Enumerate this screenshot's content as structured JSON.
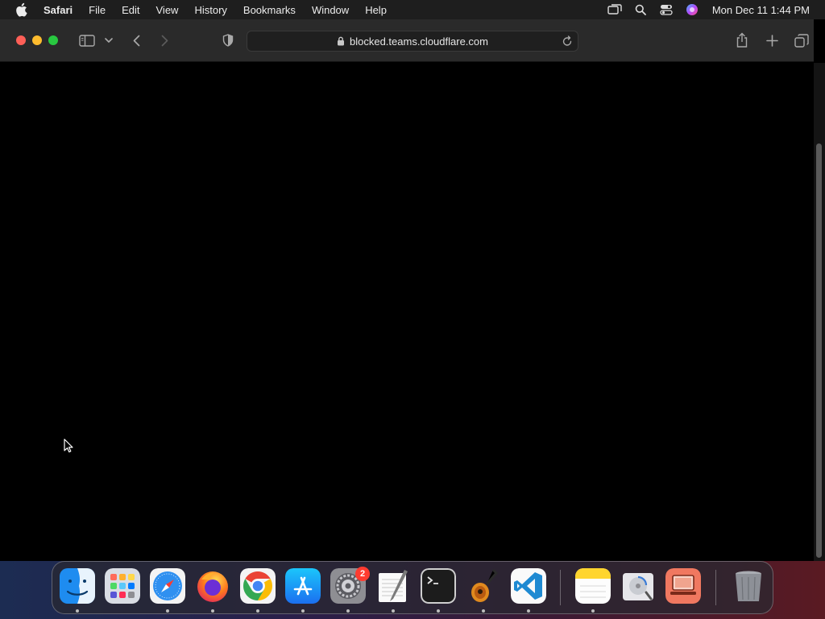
{
  "menubar": {
    "app_name": "Safari",
    "items": [
      "File",
      "Edit",
      "View",
      "History",
      "Bookmarks",
      "Window",
      "Help"
    ],
    "clock": "Mon Dec 11  1:44 PM"
  },
  "toolbar": {
    "url": "blocked.teams.cloudflare.com"
  },
  "dock": {
    "settings_badge": "2",
    "apps": [
      "Finder",
      "Launchpad",
      "Safari",
      "Firefox",
      "Google Chrome",
      "App Store",
      "System Settings",
      "TextEdit",
      "Terminal",
      "GarageBand",
      "Visual Studio Code",
      "Notes",
      "Disk Utility",
      "Screen Sharing",
      "Trash"
    ]
  },
  "colors": {
    "close": "#fe5f57",
    "minimize": "#febc2e",
    "maximize": "#28c840",
    "badge": "#ff3b30"
  }
}
